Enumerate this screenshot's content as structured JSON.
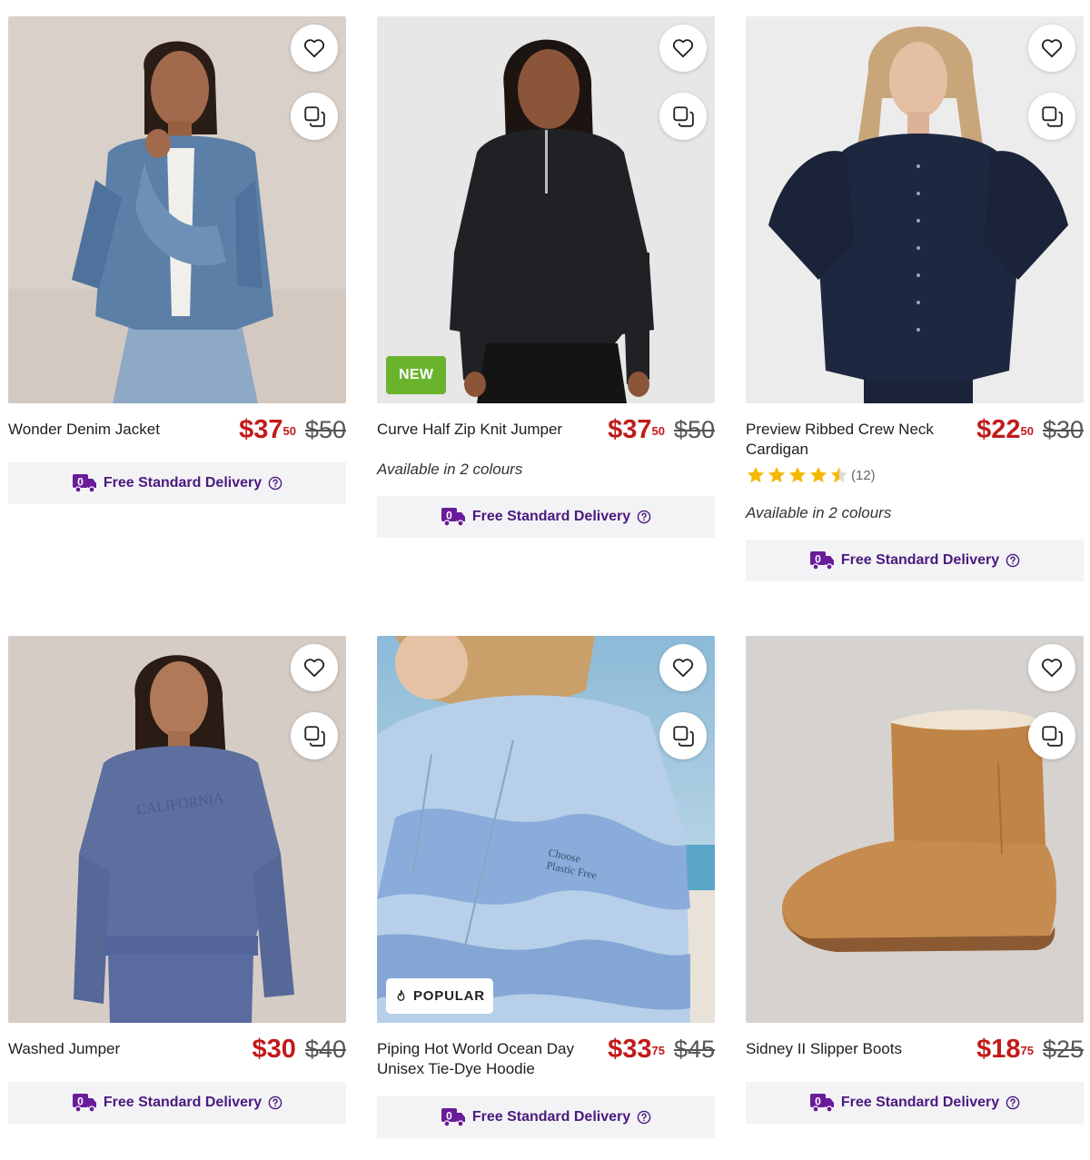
{
  "products": [
    {
      "title": "Wonder Denim Jacket",
      "price_dollars": "$37",
      "price_cents": "50",
      "was_price": "$50",
      "delivery": "Free Standard Delivery"
    },
    {
      "title": "Curve Half Zip Knit Jumper",
      "price_dollars": "$37",
      "price_cents": "50",
      "was_price": "$50",
      "badge": "NEW",
      "colours": "Available in 2 colours",
      "delivery": "Free Standard Delivery"
    },
    {
      "title": "Preview Ribbed Crew Neck Cardigan",
      "price_dollars": "$22",
      "price_cents": "50",
      "was_price": "$30",
      "rating": 4.5,
      "rating_count": "(12)",
      "colours": "Available in 2 colours",
      "delivery": "Free Standard Delivery"
    },
    {
      "title": "Washed Jumper",
      "price_dollars": "$30",
      "price_cents": "",
      "was_price": "$40",
      "delivery": "Free Standard Delivery"
    },
    {
      "title": "Piping Hot World Ocean Day Unisex Tie-Dye Hoodie",
      "price_dollars": "$33",
      "price_cents": "75",
      "was_price": "$45",
      "badge": "POPULAR",
      "delivery": "Free Standard Delivery"
    },
    {
      "title": "Sidney II Slipper Boots",
      "price_dollars": "$18",
      "price_cents": "75",
      "was_price": "$25",
      "delivery": "Free Standard Delivery"
    }
  ],
  "icons": {
    "wishlist": "heart-icon",
    "compare": "compare-icon",
    "delivery": "delivery-truck-icon",
    "help": "help-icon",
    "popular": "flame-icon",
    "star": "star-icon"
  },
  "colors": {
    "sale_price": "#c21a1a",
    "delivery_text": "#4a1a7e",
    "delivery_bg": "#f3f3f5",
    "new_badge": "#6ab42d",
    "star": "#f5b800"
  }
}
